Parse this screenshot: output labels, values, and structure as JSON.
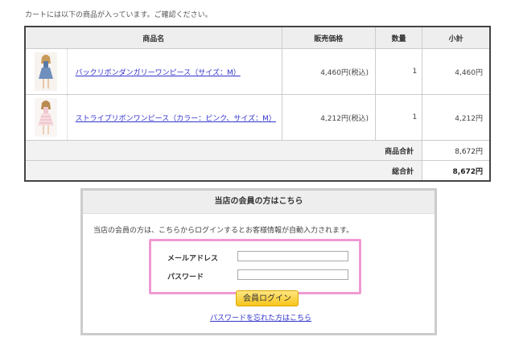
{
  "intro_text": "カートには以下の商品が入っています。ご確認ください。",
  "cart": {
    "headers": {
      "name": "商品名",
      "price": "販売価格",
      "qty": "数量",
      "subtotal": "小計"
    },
    "items": [
      {
        "name": "バックリボンダンガリーワンピース（サイズ：M）",
        "price": "4,460円(税込)",
        "qty": "1",
        "subtotal": "4,460円"
      },
      {
        "name": "ストライプリボンワンピース（カラー：ピンク、サイズ：M）",
        "price": "4,212円(税込)",
        "qty": "1",
        "subtotal": "4,212円"
      }
    ],
    "product_total_label": "商品合計",
    "product_total_value": "8,672円",
    "grand_total_label": "総合計",
    "grand_total_value": "8,672円"
  },
  "login": {
    "title": "当店の会員の方はこちら",
    "description": "当店の会員の方は、こちらからログインするとお客様情報が自動入力されます。",
    "email_label": "メールアドレス",
    "email_value": "",
    "password_label": "パスワード",
    "password_value": "",
    "button_label": "会員ログイン",
    "forgot_link": "パスワードを忘れた方はこちら"
  }
}
